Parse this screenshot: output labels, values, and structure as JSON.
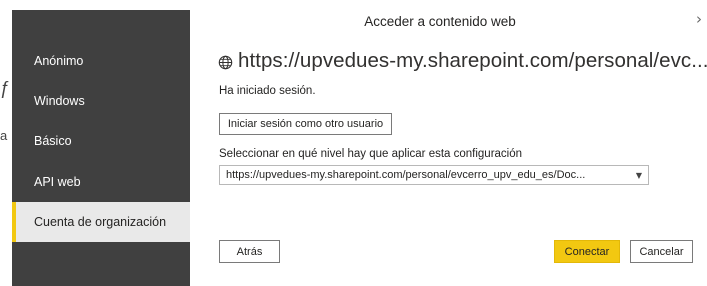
{
  "background": {
    "fragments": [
      "ƒ",
      "a"
    ]
  },
  "sidebar": {
    "items": [
      {
        "label": "Anónimo",
        "active": false
      },
      {
        "label": "Windows",
        "active": false
      },
      {
        "label": "Básico",
        "active": false
      },
      {
        "label": "API web",
        "active": false
      },
      {
        "label": "Cuenta de organización",
        "active": true
      }
    ]
  },
  "dialog": {
    "title": "Acceder a contenido web",
    "close_glyph": "›",
    "url_icon": "globe-icon",
    "url": "https://upvedues-my.sharepoint.com/personal/evc...",
    "signed_in_text": "Ha iniciado sesión.",
    "other_user_button": "Iniciar sesión como otro usuario",
    "level_label": "Seleccionar en qué nivel hay que aplicar esta configuración",
    "level_value": "https://upvedues-my.sharepoint.com/personal/evcerro_upv_edu_es/Doc...",
    "back_button": "Atrás",
    "connect_button": "Conectar",
    "cancel_button": "Cancelar"
  },
  "colors": {
    "sidebar_bg": "#404040",
    "active_item_bg": "#e9e9e9",
    "accent": "#f2c811"
  }
}
